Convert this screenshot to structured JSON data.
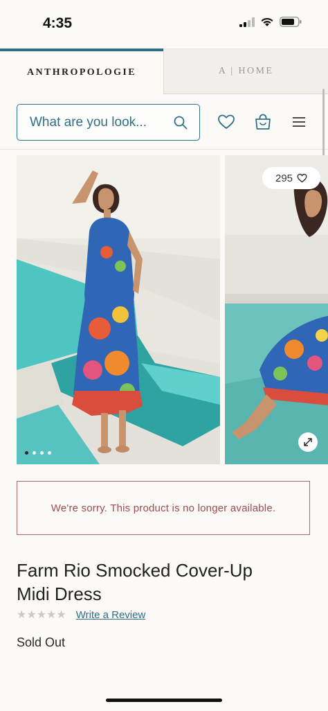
{
  "status_bar": {
    "time": "4:35"
  },
  "brand_tabs": {
    "active": "ANTHROPOLOGIE",
    "inactive": "A | HOME"
  },
  "search": {
    "placeholder": "What are you look..."
  },
  "gallery": {
    "like_count": "295",
    "image_count": 4,
    "active_index": 0
  },
  "notice": {
    "text": "We're sorry. This product is no longer available."
  },
  "product": {
    "title_line1": "Farm Rio Smocked Cover-Up",
    "title_line2": "Midi Dress",
    "stars": "★★★★★",
    "review_link": "Write a Review",
    "status": "Sold Out"
  },
  "colors": {
    "accent": "#2f6f86",
    "error": "#a24a4f",
    "background": "#fbfaf6"
  }
}
